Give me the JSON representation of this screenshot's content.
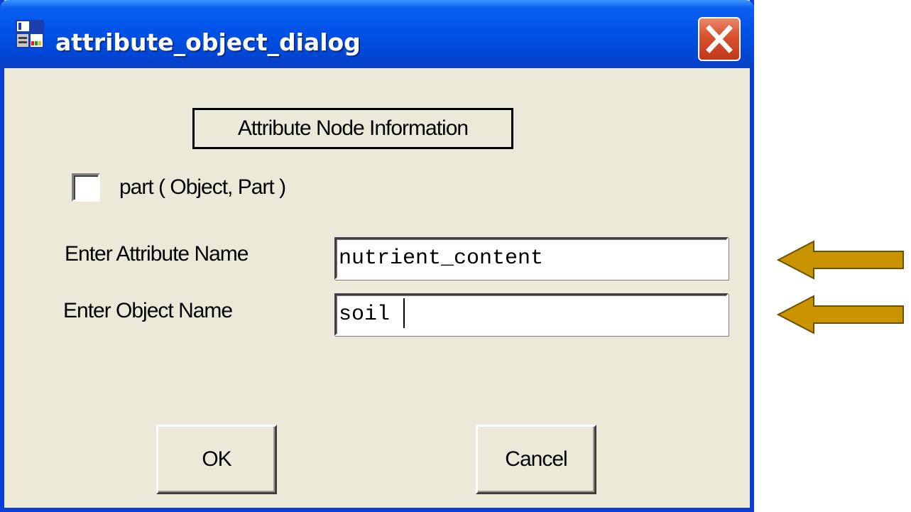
{
  "window": {
    "title": "attribute_object_dialog",
    "close_label": "×"
  },
  "group": {
    "label": "Attribute Node Information"
  },
  "checkbox": {
    "label": "part ( Object, Part )",
    "checked": false
  },
  "fields": {
    "attribute_label": "Enter Attribute Name",
    "attribute_value": "nutrient_content",
    "object_label": "Enter Object Name",
    "object_value": "soil"
  },
  "buttons": {
    "ok": "OK",
    "cancel": "Cancel"
  },
  "colors": {
    "dialog_bg": "#ECE9D8",
    "titlebar": "#0052E6",
    "close_button": "#D9542F",
    "arrow_fill": "#C99400",
    "arrow_stroke": "#6B5200"
  },
  "annotations": {
    "arrows": [
      "arrow-left-icon",
      "arrow-left-icon"
    ]
  }
}
